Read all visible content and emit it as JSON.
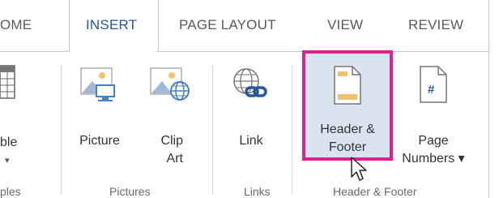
{
  "tabs": [
    {
      "label": "OME"
    },
    {
      "label": "INSERT"
    },
    {
      "label": "PAGE LAYOUT"
    },
    {
      "label": "VIEW"
    },
    {
      "label": "REVIEW"
    }
  ],
  "ribbon": {
    "table": {
      "label_line1": "ble",
      "label_line2": "▾"
    },
    "picture": {
      "label": "Picture"
    },
    "clip_art": {
      "label_line1": "Clip",
      "label_line2": "Art"
    },
    "link": {
      "label": "Link"
    },
    "header_footer": {
      "label_line1": "Header &",
      "label_line2": "Footer"
    },
    "page_numbers": {
      "label_line1": "Page",
      "label_line2": "Numbers ▾",
      "icon_text": "#"
    }
  },
  "groups": {
    "tables": "ples",
    "pictures": "Pictures",
    "links": "Links",
    "header_footer": "Header & Footer"
  },
  "colors": {
    "active_tab": "#2b579a",
    "highlight_border": "#e0208c",
    "selected_bg": "#dae4f1",
    "icon_blue": "#4a7fc1",
    "icon_orange": "#f2c26b"
  }
}
